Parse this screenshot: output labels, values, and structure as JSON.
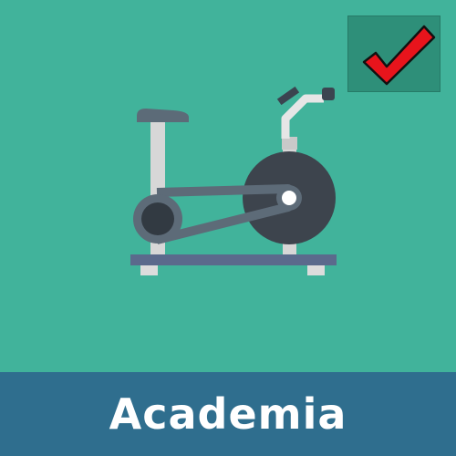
{
  "tile": {
    "caption": "Academia",
    "background_color": "#41b39b",
    "caption_bar_color": "#2f6e8e"
  },
  "badge": {
    "icon": "checkmark-icon",
    "check_color": "#e8141c",
    "badge_color": "#2e8f79"
  },
  "illustration": {
    "icon": "exercise-bike-icon"
  }
}
